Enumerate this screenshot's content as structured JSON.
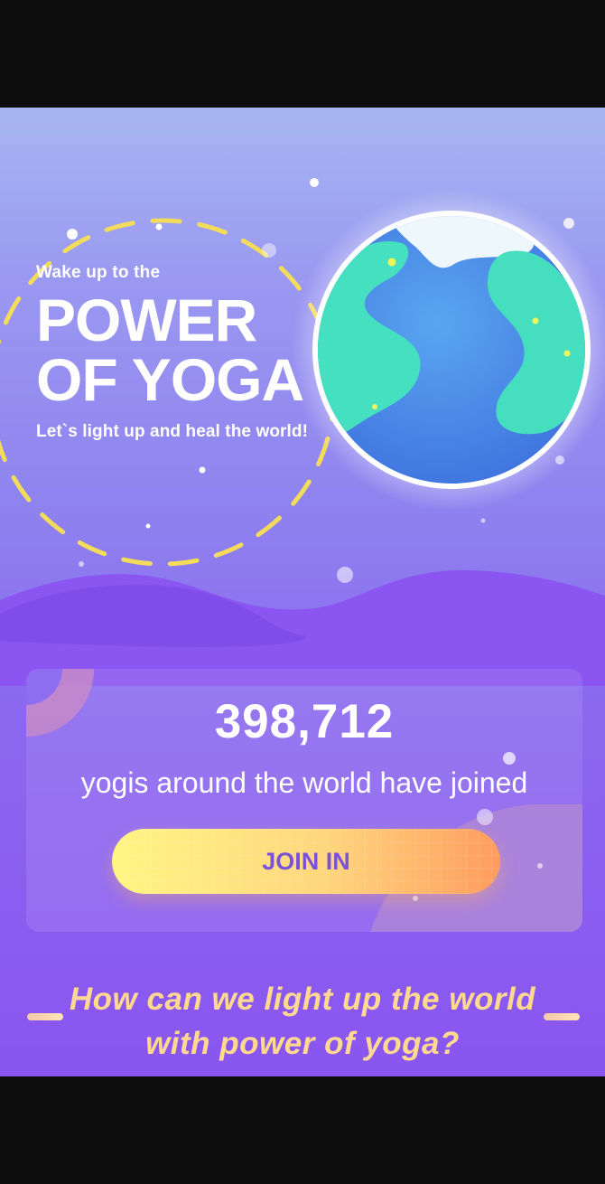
{
  "hero": {
    "subtitle": "Wake up to the",
    "title_line1": "POWER",
    "title_line2": "OF YOGA",
    "tagline": "Let`s light up and heal the world!"
  },
  "stats": {
    "count": "398,712",
    "description": "yogis around the world have joined",
    "join_label": "JOIN IN"
  },
  "question": {
    "line1": "How can we light up the world",
    "line2": "with power of yoga?"
  },
  "colors": {
    "background_top": "#a7b6f2",
    "background_bottom": "#8a55f0",
    "button_start": "#fff684",
    "button_end": "#ff9c5e",
    "button_text": "#7a52d8",
    "question_text": "#ffd991",
    "dashed_orbit": "#f2dc5a"
  },
  "icons": {
    "globe": "earth-globe-icon",
    "orbit": "dashed-orbit-ring"
  }
}
